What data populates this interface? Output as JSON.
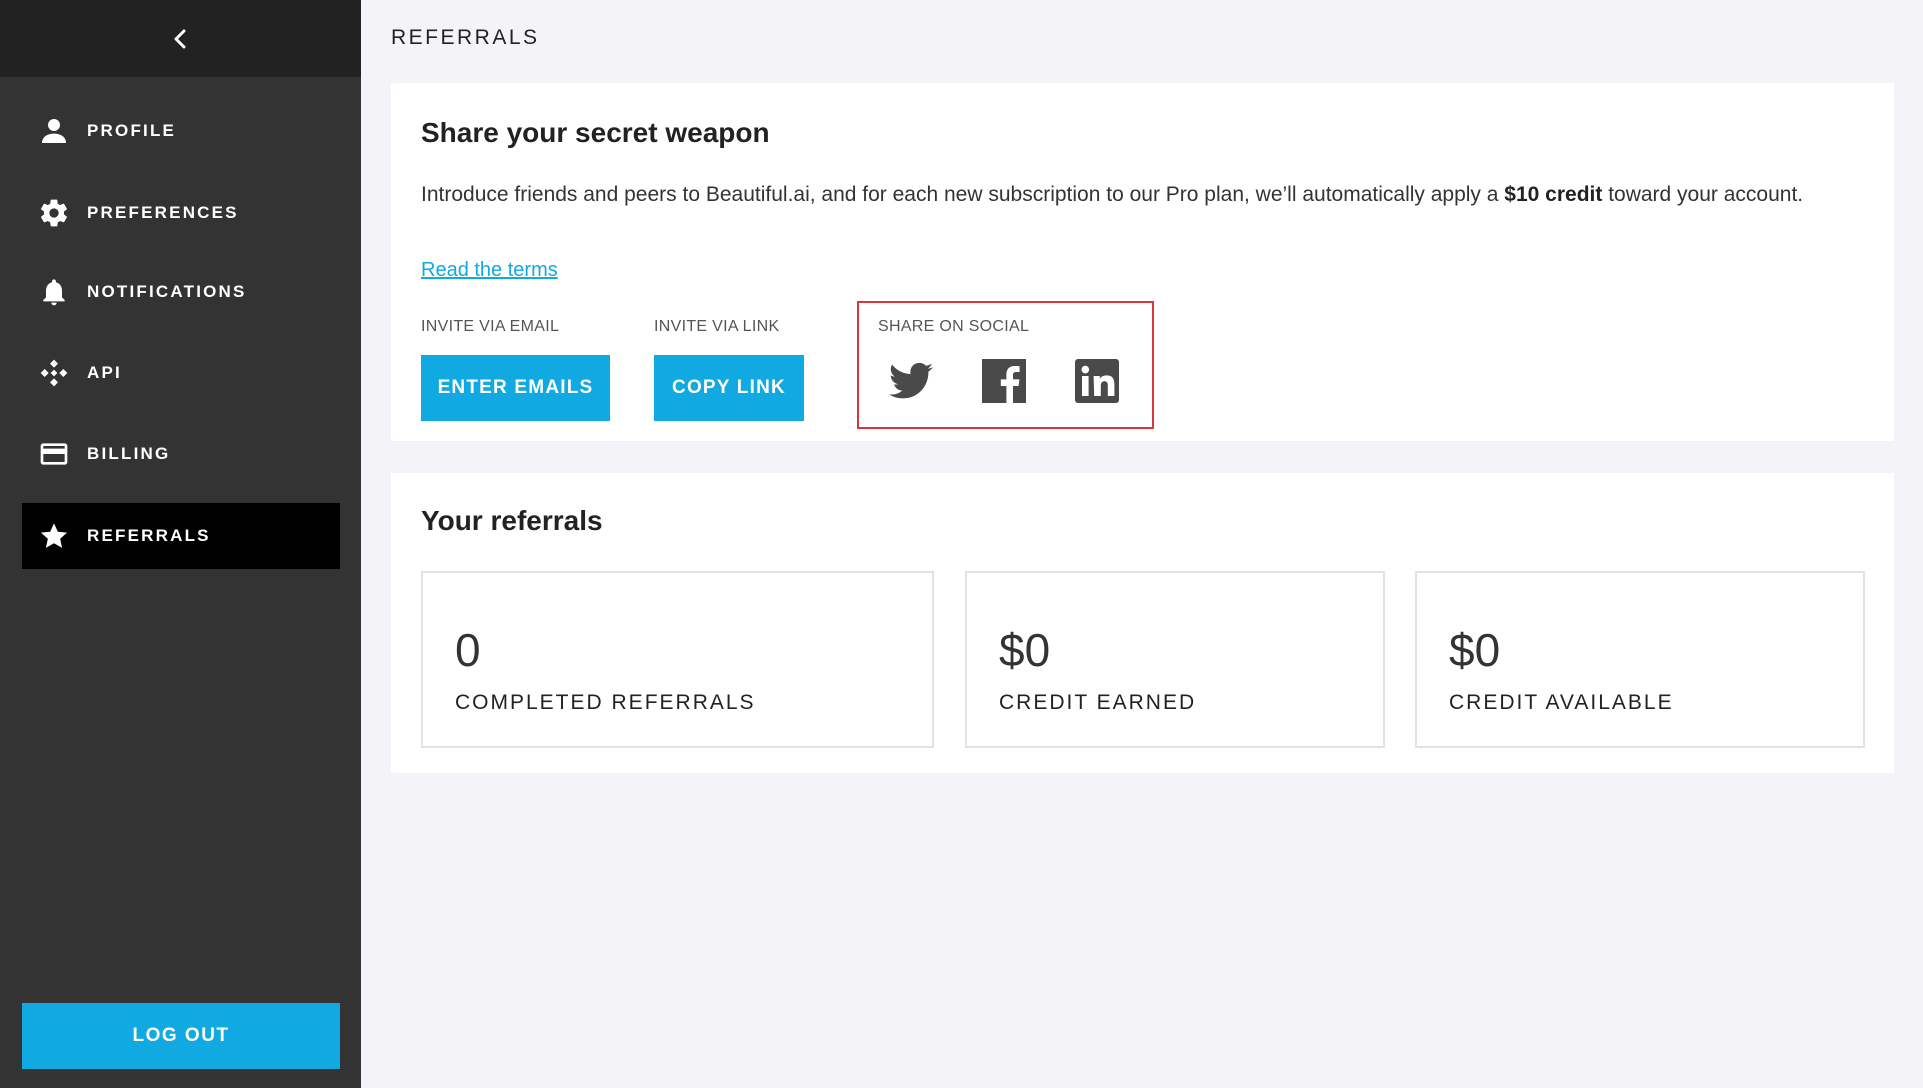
{
  "sidebar": {
    "back_icon": "chevron-left-icon",
    "items": [
      {
        "label": "PROFILE",
        "icon": "person-icon"
      },
      {
        "label": "PREFERENCES",
        "icon": "gear-icon"
      },
      {
        "label": "NOTIFICATIONS",
        "icon": "bell-icon"
      },
      {
        "label": "API",
        "icon": "api-icon"
      },
      {
        "label": "BILLING",
        "icon": "credit-card-icon"
      },
      {
        "label": "REFERRALS",
        "icon": "star-icon",
        "active": true
      }
    ],
    "logout_label": "LOG OUT"
  },
  "main": {
    "page_title": "REFERRALS",
    "share": {
      "title": "Share your secret weapon",
      "intro_before": "Introduce friends and peers to Beautiful.ai, and for each new subscription to our Pro plan, we’ll automatically apply a ",
      "intro_bold": "$10 credit",
      "intro_after": " toward your account.",
      "terms_link": "Read the terms",
      "email_label": "INVITE VIA EMAIL",
      "email_button": "ENTER EMAILS",
      "link_label": "INVITE VIA LINK",
      "link_button": "COPY LINK",
      "social_label": "SHARE ON SOCIAL",
      "social_icons": [
        "twitter-icon",
        "facebook-icon",
        "linkedin-icon"
      ]
    },
    "referrals": {
      "title": "Your referrals",
      "stats": [
        {
          "value": "0",
          "caption": "COMPLETED REFERRALS"
        },
        {
          "value": "$0",
          "caption": "CREDIT EARNED"
        },
        {
          "value": "$0",
          "caption": "CREDIT AVAILABLE"
        }
      ]
    }
  },
  "colors": {
    "accent": "#11a9e2",
    "sidebar_bg": "#333333",
    "sidebar_top_bg": "#222222",
    "active_bg": "#000000",
    "highlight_border": "#d9373d",
    "social_icon": "#4a4a4a"
  }
}
